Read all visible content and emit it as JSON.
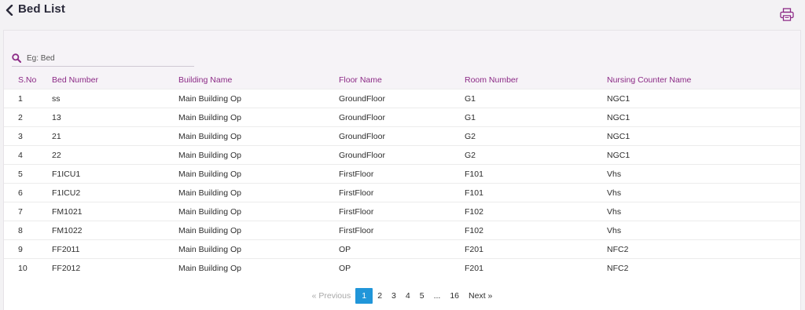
{
  "header": {
    "title": "Bed List",
    "back_icon": "chevron-left-icon",
    "print_icon": "printer-icon"
  },
  "search": {
    "placeholder": "Eg: Bed",
    "value": "",
    "icon": "search-icon"
  },
  "table": {
    "columns": [
      "S.No",
      "Bed Number",
      "Building Name",
      "Floor Name",
      "Room Number",
      "Nursing Counter Name"
    ],
    "rows": [
      [
        "1",
        "ss",
        "Main Building Op",
        "GroundFloor",
        "G1",
        "NGC1"
      ],
      [
        "2",
        "13",
        "Main Building Op",
        "GroundFloor",
        "G1",
        "NGC1"
      ],
      [
        "3",
        "21",
        "Main Building Op",
        "GroundFloor",
        "G2",
        "NGC1"
      ],
      [
        "4",
        "22",
        "Main Building Op",
        "GroundFloor",
        "G2",
        "NGC1"
      ],
      [
        "5",
        "F1ICU1",
        "Main Building Op",
        "FirstFloor",
        "F101",
        "Vhs"
      ],
      [
        "6",
        "F1ICU2",
        "Main Building Op",
        "FirstFloor",
        "F101",
        "Vhs"
      ],
      [
        "7",
        "FM1021",
        "Main Building Op",
        "FirstFloor",
        "F102",
        "Vhs"
      ],
      [
        "8",
        "FM1022",
        "Main Building Op",
        "FirstFloor",
        "F102",
        "Vhs"
      ],
      [
        "9",
        "FF2011",
        "Main Building Op",
        "OP",
        "F201",
        "NFC2"
      ],
      [
        "10",
        "FF2012",
        "Main Building Op",
        "OP",
        "F201",
        "NFC2"
      ]
    ]
  },
  "pagination": {
    "previous": "« Previous",
    "pages": [
      "1",
      "2",
      "3",
      "4",
      "5",
      "...",
      "16"
    ],
    "current": "1",
    "next": "Next »"
  },
  "colors": {
    "accent": "#8c2a86",
    "active_page": "#2196d9",
    "header_band": "#f6f3f7"
  }
}
